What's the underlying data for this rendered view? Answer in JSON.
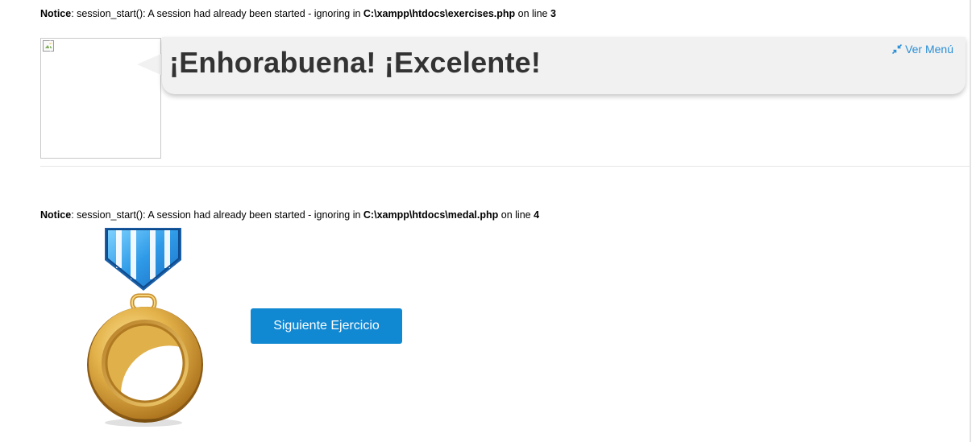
{
  "notices": [
    {
      "label": "Notice",
      "message": ": session_start(): A session had already been started - ignoring in ",
      "path": "C:\\xampp\\htdocs\\exercises.php",
      "on_line": " on line ",
      "line": "3"
    },
    {
      "label": "Notice",
      "message": ": session_start(): A session had already been started - ignoring in ",
      "path": "C:\\xampp\\htdocs\\medal.php",
      "on_line": " on line ",
      "line": "4"
    }
  ],
  "header": {
    "title": "¡Enhorabuena! ¡Excelente!",
    "menu_link": "Ver Menú",
    "menu_icon": "collapse-arrows-icon"
  },
  "avatar": {
    "icon": "broken-image-icon"
  },
  "medal": {
    "icon": "medal-icon",
    "ribbon_color": "#2f9be8",
    "gold_color": "#d9a63a"
  },
  "actions": {
    "next_label": "Siguiente Ejercicio"
  },
  "colors": {
    "accent": "#1188d2",
    "link": "#2a8fd6",
    "bubble": "#f1f1f1",
    "title": "#333333"
  }
}
